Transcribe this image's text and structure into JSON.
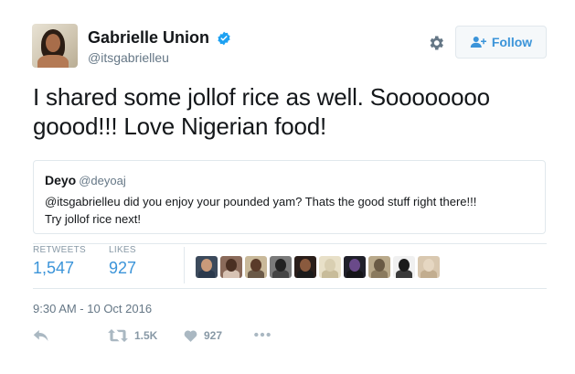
{
  "author": {
    "display_name": "Gabrielle Union",
    "handle": "@itsgabrielleu",
    "verified": true
  },
  "header": {
    "follow_label": "Follow",
    "settings_icon": "gear-icon",
    "follow_icon": "add-user-icon"
  },
  "tweet": {
    "text": "I shared some jollof rice as well. Soooooooo goood!!! Love Nigerian food!"
  },
  "quoted_tweet": {
    "name": "Deyo",
    "handle": "@deyoaj",
    "text_line1": "@itsgabrielleu did you enjoy your pounded yam? Thats the good stuff right there!!!",
    "text_line2": "Try jollof rice next!"
  },
  "stats": {
    "retweets_label": "RETWEETS",
    "retweets_value": "1,547",
    "likes_label": "LIKES",
    "likes_value": "927"
  },
  "likers": [
    {
      "bg": "#3c4a5c",
      "head": "#c99a7a",
      "body": "#2b3a4d"
    },
    {
      "bg": "#8a6a5a",
      "head": "#4a2f22",
      "body": "#d7c2b3"
    },
    {
      "bg": "#c9b99a",
      "head": "#5a3b2a",
      "body": "#6b5a48"
    },
    {
      "bg": "#7a7a7a",
      "head": "#222222",
      "body": "#444444"
    },
    {
      "bg": "#2a1e1a",
      "head": "#8a5a3e",
      "body": "#1b1b1b"
    },
    {
      "bg": "#e8e0c8",
      "head": "#d9cfb2",
      "body": "#c8bc9a"
    },
    {
      "bg": "#20202a",
      "head": "#6a4a8a",
      "body": "#151518"
    },
    {
      "bg": "#b9a98a",
      "head": "#6a5a44",
      "body": "#8a7a5e"
    },
    {
      "bg": "#f0f0f0",
      "head": "#1b1b1b",
      "body": "#3a3a3a"
    },
    {
      "bg": "#d9c8b0",
      "head": "#e6d7c2",
      "body": "#c2ad8f"
    }
  ],
  "timestamp": "9:30 AM - 10 Oct 2016",
  "actions": {
    "reply_icon": "reply-icon",
    "retweet_icon": "retweet-icon",
    "retweet_count": "1.5K",
    "like_icon": "heart-icon",
    "like_count": "927",
    "more_icon": "more-icon"
  },
  "colors": {
    "accent": "#3b94d9",
    "verified": "#1da1f2",
    "muted": "#657786",
    "border": "#e1e8ed"
  }
}
